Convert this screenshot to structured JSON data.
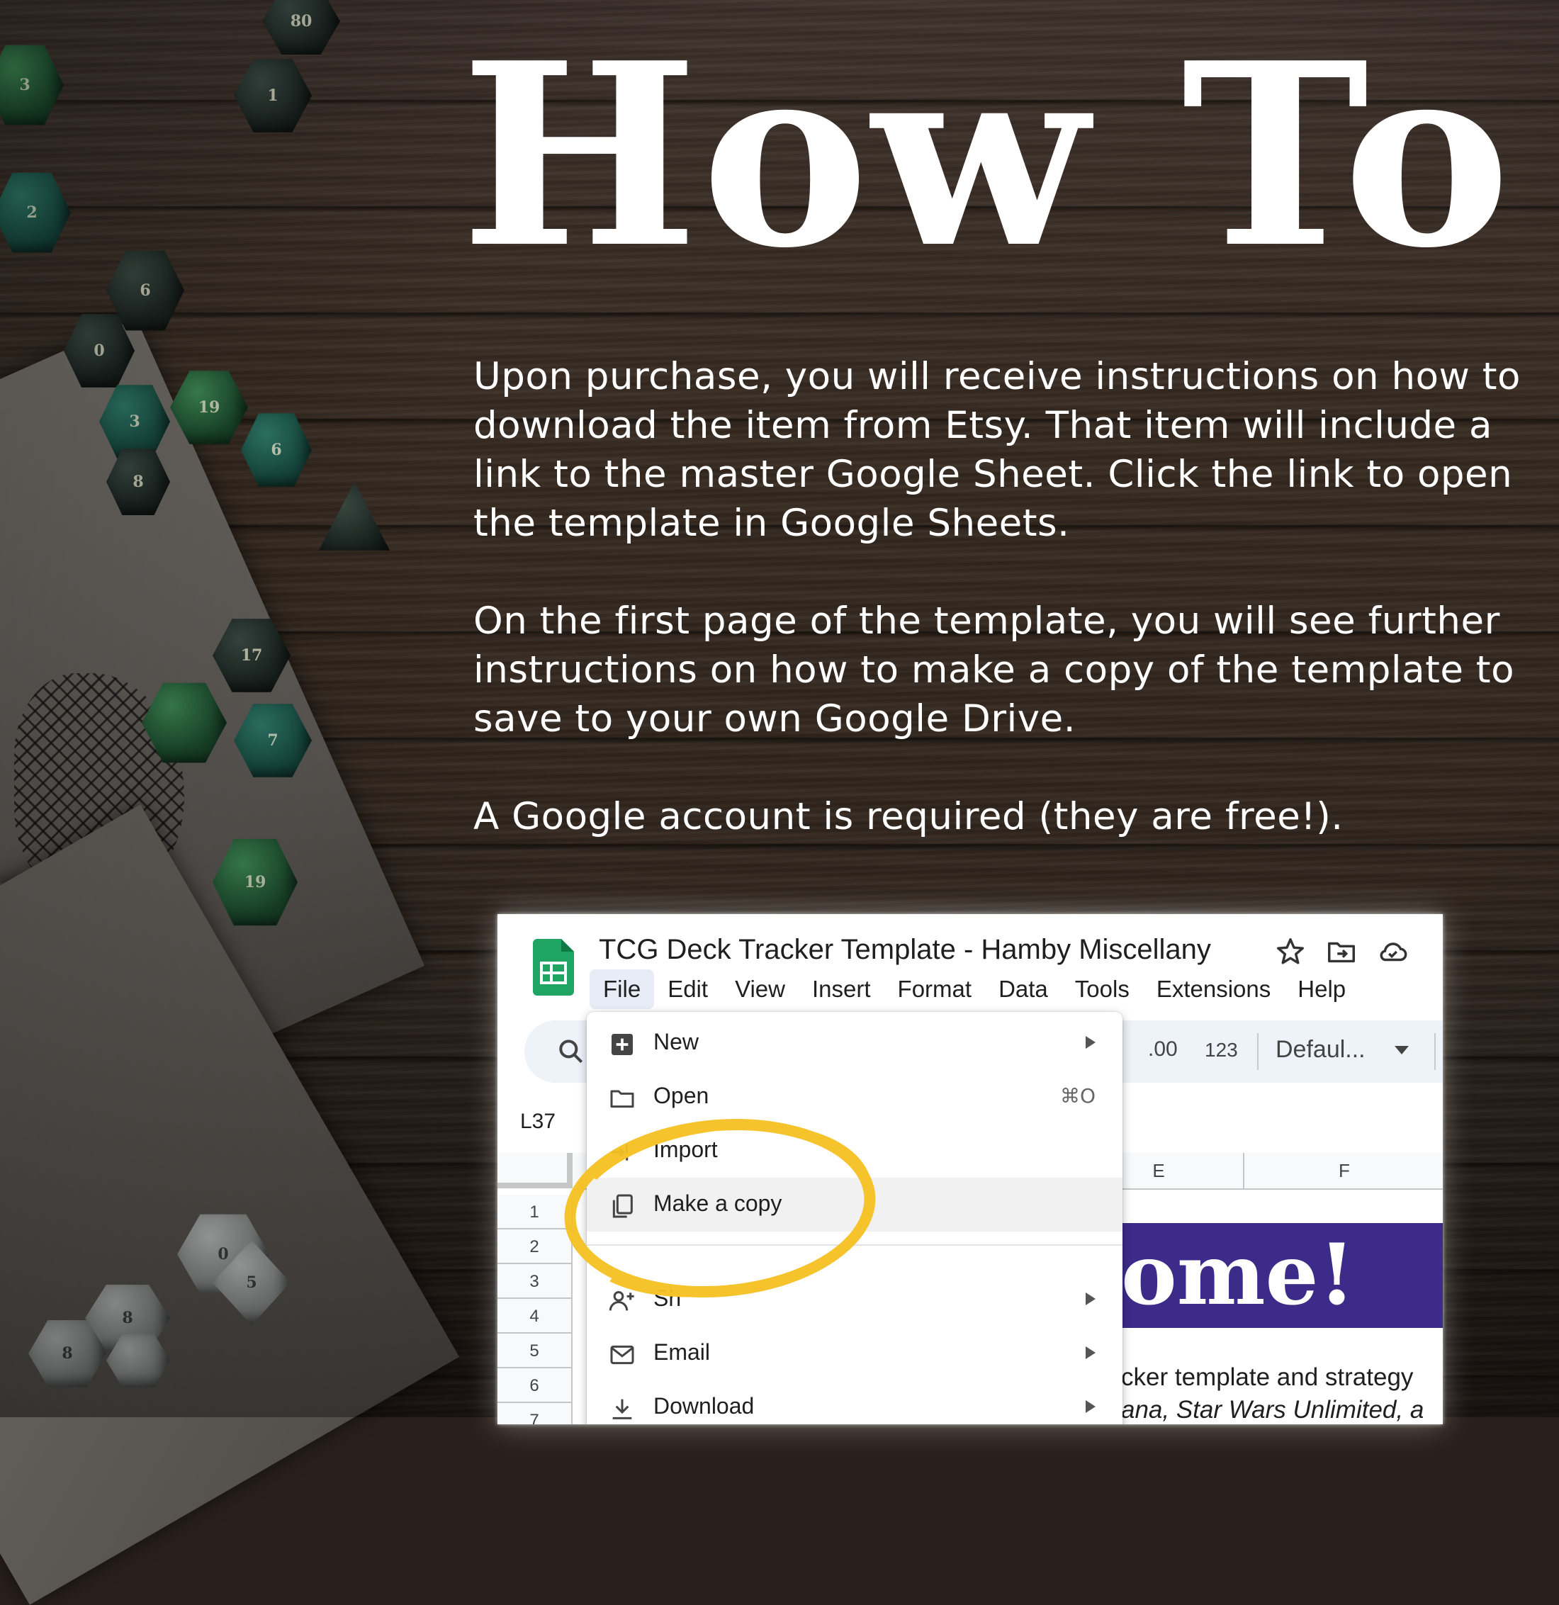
{
  "heading": "How To",
  "paragraphs": [
    "Upon purchase, you will receive instructions on how to download the item from Etsy. That item will include a link to the master Google Sheet. Click the link to open the template in Google Sheets.",
    "On the first page of the template, you will see further instructions on how to make a copy of the template to save to your own Google Drive.",
    "A Google account is required (they are free!)."
  ],
  "sheets": {
    "doc_title": "TCG Deck Tracker Template - Hamby Miscellany",
    "title_icons": [
      "star-icon",
      "move-to-folder-icon",
      "cloud-status-icon"
    ],
    "menus": [
      "File",
      "Edit",
      "View",
      "Insert",
      "Format",
      "Data",
      "Tools",
      "Extensions",
      "Help"
    ],
    "active_menu": "File",
    "toolbar": {
      "decimal": ".00",
      "number_format": "123",
      "font": "Defaul...",
      "minus": "–"
    },
    "name_box": "L37",
    "columns": [
      "E",
      "F"
    ],
    "rows": [
      "1",
      "2",
      "3",
      "4",
      "5",
      "6",
      "7"
    ],
    "banner_text": "ome!",
    "banner_color": "#3d2b8a",
    "desc_line_1": "cker template and strategy",
    "desc_line_2": "ana, Star Wars Unlimited, a"
  },
  "file_menu": {
    "items": [
      {
        "label": "New",
        "icon": "new-sheet-icon",
        "submenu": true
      },
      {
        "label": "Open",
        "icon": "folder-icon",
        "shortcut": "⌘O"
      },
      {
        "label": "Import",
        "icon": "import-icon"
      },
      {
        "label": "Make a copy",
        "icon": "copy-icon",
        "highlighted": true
      },
      {
        "label": "Sh",
        "icon": "share-icon",
        "submenu": true
      },
      {
        "label": "Email",
        "icon": "email-icon",
        "submenu": true
      },
      {
        "label": "Download",
        "icon": "download-icon",
        "submenu": true
      }
    ]
  },
  "highlight_color": "#f4c021"
}
